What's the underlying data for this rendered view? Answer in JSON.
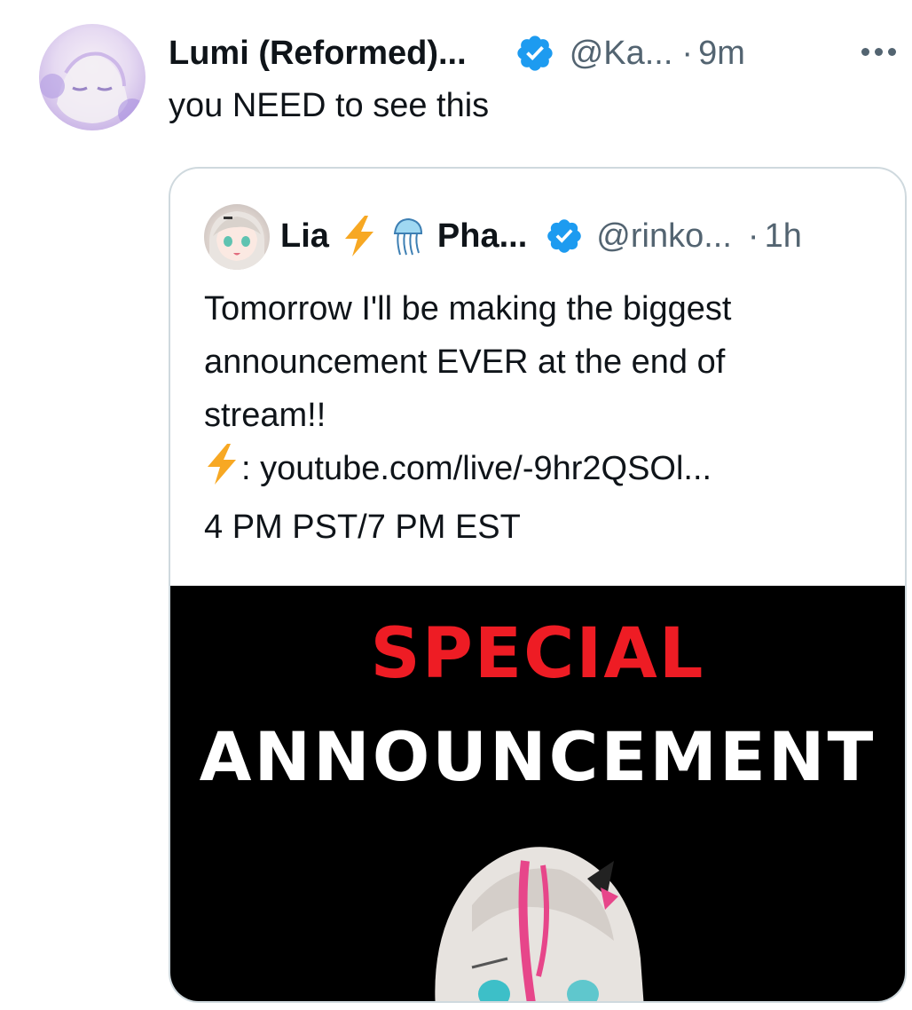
{
  "tweet": {
    "display_name": "Lumi (Reformed)...",
    "handle": "@Ka...",
    "separator": "·",
    "time": "9m",
    "text": "you NEED to see this",
    "avatar_icon": "anime-avatar"
  },
  "quoted": {
    "name": "Lia",
    "emoji_1": "lightning-bolt-emoji",
    "emoji_2": "jellyfish-emoji",
    "name_2": "Pha...",
    "handle": "@rinko...",
    "separator": "·",
    "time": "1h",
    "lines": [
      "Tomorrow I'll be making the biggest",
      "announcement EVER at the end of",
      "stream!!",
      ": youtube.com/live/-9hr2QSOl...",
      "4 PM PST/7 PM EST"
    ],
    "image": {
      "title_1": "SPECIAL",
      "title_2": "ANNOUNCEMENT"
    }
  },
  "colors": {
    "verified": "#1d9bf0",
    "secondary_text": "#536471",
    "special_red": "#ee1c24",
    "bolt": "#f7a823"
  }
}
